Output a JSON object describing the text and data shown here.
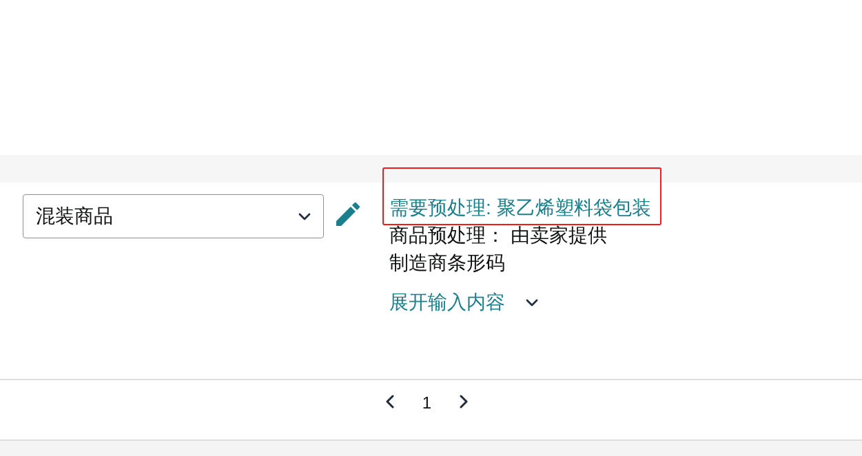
{
  "product_row": {
    "type_select": {
      "value": "混装商品"
    },
    "prep_lines": [
      {
        "kind": "link",
        "text": "需要预处理: 聚乙烯塑料袋包装",
        "highlighted": true
      },
      {
        "kind": "text",
        "text": "商品预处理： 由卖家提供",
        "highlighted": false
      },
      {
        "kind": "text",
        "text": "制造商条形码",
        "highlighted": false
      }
    ],
    "expand_toggle": {
      "label": "展开输入内容",
      "expanded": false
    }
  },
  "pagination": {
    "page": "1"
  }
}
